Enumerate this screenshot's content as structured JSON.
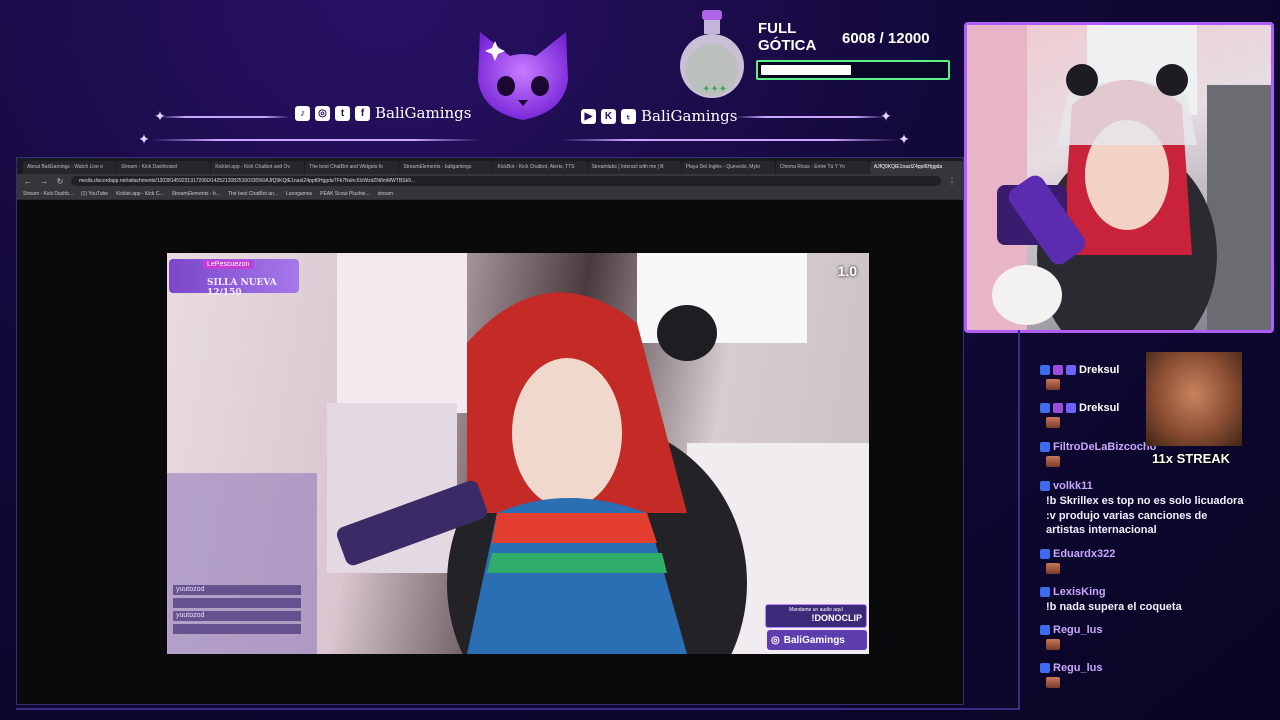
{
  "overlay": {
    "social_left": {
      "icons": [
        "tiktok-icon",
        "instagram-icon",
        "twitter-icon",
        "facebook-icon"
      ],
      "handle": "BaliGamings"
    },
    "social_right": {
      "icons": [
        "youtube-icon",
        "kick-icon",
        "twitch-icon"
      ],
      "handle": "BaliGamings"
    },
    "goal": {
      "title_line1": "FULL",
      "title_line2": "GÓTICA",
      "current": "6008",
      "target": "/ 12000",
      "progress": 0.5
    }
  },
  "browser": {
    "tabs": [
      "About BaliGamings - Watch Live o",
      "Stream - Kick Dashboard",
      "Kicklet.app - Kick Chatbot and Ov",
      "The best ChatBot and Widgets fo",
      "StreamElements - baligamings",
      "KickBot - Kick Chatbot, Alerts, TTS",
      "Streamlabs | Interact with me | B",
      "Playa Del Inglés - Quevedo, Mylo",
      "Chema Rivas - Entre Tú Y Yo",
      "AJfQ9KQtE1nasIZ4ppt6Hggda"
    ],
    "active_tab_index": 9,
    "url": "media.discordapp.net/attachments/1203814592313172060/1425213082510033056/AJfQ9KQtE1nasIZ4ppt6HggdaTFk7Nuhc6IzWzdZN8mMWTBSk9...",
    "bookmarks": [
      "Stream - Kick Dashb...",
      "(1) YouTube",
      "Kicklet.app - Kick C...",
      "StreamElements - b...",
      "The best ChatBot an...",
      "Leoogames",
      "PEAK Scout Plushie...",
      "stream"
    ]
  },
  "video": {
    "badge_user": "LePescuezon",
    "badge_text": "SILLA NUEVA 12/150",
    "multiplier": "1.0",
    "clip_small": "Mandame un audio aquí",
    "clip_cmd": "!DONOCLIP",
    "handle": "BaliGamings",
    "chat_names": [
      "yuutozod",
      "yuutozod"
    ]
  },
  "chat": {
    "messages": [
      {
        "user": "Dreksul",
        "color": "#ffffff",
        "text": ""
      },
      {
        "user": "Dreksul",
        "color": "#ffffff",
        "text": ""
      },
      {
        "user": "FiltroDeLaBizcocho",
        "color": "#c8a6ff",
        "text": ""
      },
      {
        "user": "volkk11",
        "color": "#c8a6ff",
        "text": "!b Skrillex es top no es solo licuadora :v produjo varias canciones de artistas internacional"
      },
      {
        "user": "Eduardx322",
        "color": "#c8a6ff",
        "text": ""
      },
      {
        "user": "LexisKing",
        "color": "#c8a6ff",
        "text": "!b nada supera el coqueta"
      },
      {
        "user": "Regu_lus",
        "color": "#c8a6ff",
        "text": ""
      },
      {
        "user": "Regu_lus",
        "color": "#c8a6ff",
        "text": ""
      }
    ],
    "streak": "11x STREAK"
  }
}
